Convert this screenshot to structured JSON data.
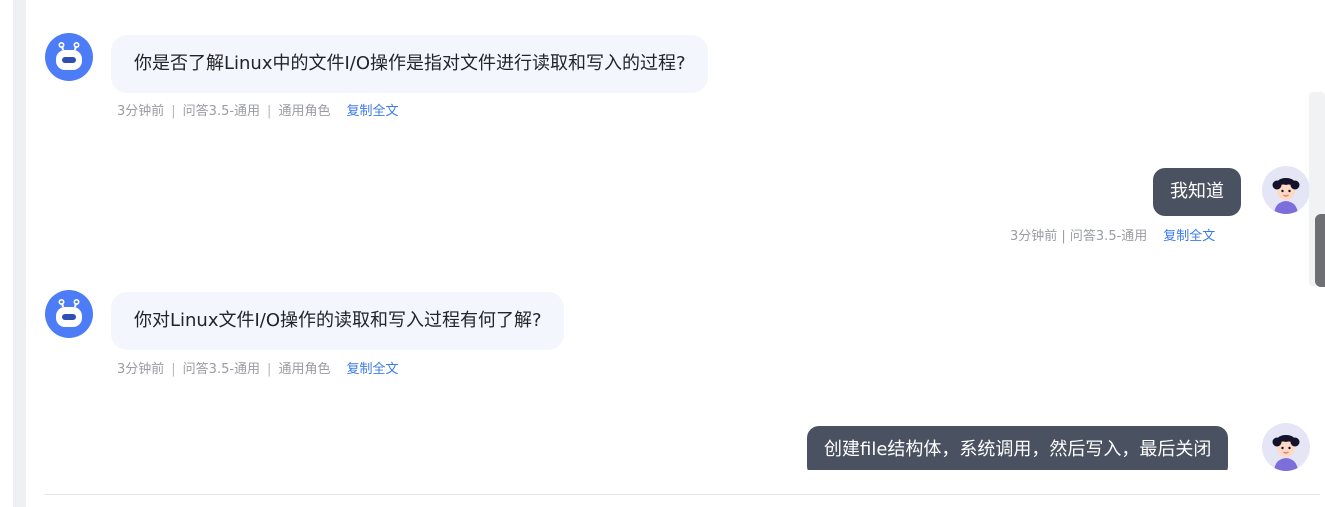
{
  "messages": [
    {
      "role": "assistant",
      "text": "你是否了解Linux中的文件I/O操作是指对文件进行读取和写入的过程?",
      "meta": {
        "time": "3分钟前",
        "model": "问答3.5-通用",
        "persona": "通用角色",
        "copy_label": "复制全文"
      }
    },
    {
      "role": "user",
      "text": "我知道",
      "meta": {
        "time_model": "3分钟前 | 问答3.5-通用",
        "copy_label": "复制全文"
      }
    },
    {
      "role": "assistant",
      "text": "你对Linux文件I/O操作的读取和写入过程有何了解?",
      "meta": {
        "time": "3分钟前",
        "model": "问答3.5-通用",
        "persona": "通用角色",
        "copy_label": "复制全文"
      }
    },
    {
      "role": "user",
      "text": "创建file结构体，系统调用，然后写入，最后关闭"
    }
  ],
  "icons": {
    "assistant_avatar": "robot-icon",
    "user_avatar": "person-avatar-icon"
  },
  "colors": {
    "accent_link": "#3c7ae8",
    "bot_avatar_bg": "#4d7cf7",
    "bot_bubble_bg": "#f4f6fd",
    "user_bubble_bg": "#4a5160",
    "user_avatar_bg": "#e4e6f6",
    "meta_text": "#9a9ca3"
  }
}
